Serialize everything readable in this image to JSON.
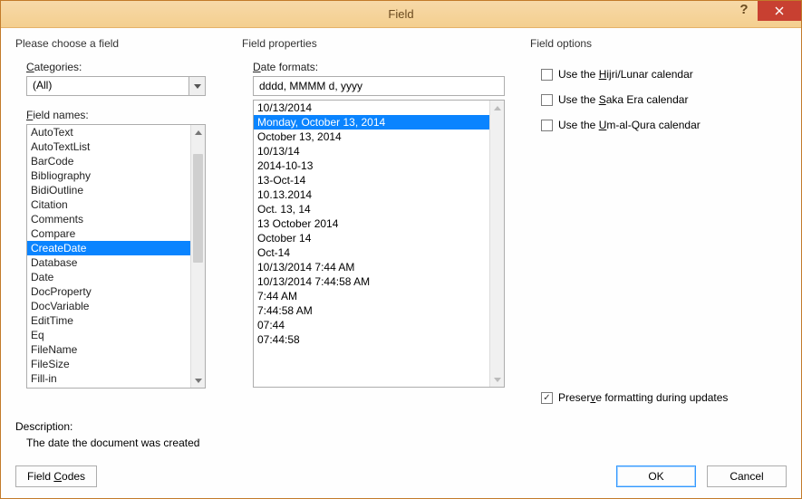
{
  "window": {
    "title": "Field"
  },
  "left": {
    "header": "Please choose a field",
    "cat_label_pre": "",
    "cat_label_u": "C",
    "cat_label_post": "ategories:",
    "category": "(All)",
    "names_label_pre": "",
    "names_label_u": "F",
    "names_label_post": "ield names:",
    "names": [
      "AutoText",
      "AutoTextList",
      "BarCode",
      "Bibliography",
      "BidiOutline",
      "Citation",
      "Comments",
      "Compare",
      "CreateDate",
      "Database",
      "Date",
      "DocProperty",
      "DocVariable",
      "EditTime",
      "Eq",
      "FileName",
      "FileSize",
      "Fill-in"
    ],
    "selected_index": 8
  },
  "mid": {
    "header": "Field properties",
    "fmt_label_pre": "",
    "fmt_label_u": "D",
    "fmt_label_post": "ate formats:",
    "input_value": "dddd, MMMM d, yyyy",
    "formats": [
      "10/13/2014",
      "Monday, October 13, 2014",
      "October 13, 2014",
      "10/13/14",
      "2014-10-13",
      "13-Oct-14",
      "10.13.2014",
      "Oct. 13, 14",
      "13 October 2014",
      "October 14",
      "Oct-14",
      "10/13/2014 7:44 AM",
      "10/13/2014 7:44:58 AM",
      "7:44 AM",
      "7:44:58 AM",
      "07:44",
      "07:44:58"
    ],
    "selected_index": 1
  },
  "right": {
    "header": "Field options",
    "opts": [
      {
        "pre": "Use the ",
        "u": "H",
        "post": "ijri/Lunar calendar",
        "checked": false
      },
      {
        "pre": "Use the ",
        "u": "S",
        "post": "aka Era calendar",
        "checked": false
      },
      {
        "pre": "Use the ",
        "u": "U",
        "post": "m-al-Qura calendar",
        "checked": false
      }
    ],
    "preserve": {
      "pre": "Preser",
      "u": "v",
      "post": "e formatting during updates",
      "checked": true
    }
  },
  "desc": {
    "label": "Description:",
    "text": "The date the document was created"
  },
  "footer": {
    "codes_pre": "Field ",
    "codes_u": "C",
    "codes_post": "odes",
    "ok": "OK",
    "cancel": "Cancel"
  }
}
